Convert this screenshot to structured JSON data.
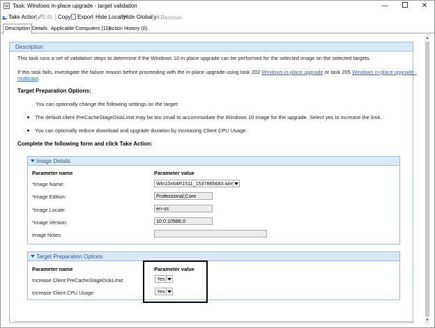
{
  "window": {
    "title": "Task: Windows in-place upgrade - target validation",
    "controls": {
      "minimize": "—",
      "close": "✕"
    }
  },
  "toolbar": {
    "take_action": "Take Action",
    "edit": "Edit",
    "copy": "Copy",
    "export": "Export",
    "hide_locally": "Hide Locally",
    "hide_globally": "Hide Globally",
    "remove": "Remove",
    "remove_icon": "✕"
  },
  "tabs": [
    {
      "label": "Description"
    },
    {
      "label": "Details"
    },
    {
      "label": "Applicable Computers (10)"
    },
    {
      "label": "Action History (0)"
    }
  ],
  "description": {
    "header": "Description",
    "intro": "This task runs a set of validation steps to determine if the Windows 10 in place upgrade can be performed for the selected image on the selected targets.",
    "fail_text_1": "If this task fails, investigate the failure reason before proceeding with the in-place upgrade using task 202 ",
    "fail_link_1": "Windows in-place upgrade",
    "fail_text_2": " or task 205 ",
    "fail_link_2a": "Windows in-place upgrade -",
    "fail_link_2b": "multicast",
    "fail_text_3": ".",
    "target_prep_title": "Target Preparation Options:",
    "optional_text": "You can optionally change the following settings on the target:",
    "bullet_1": "The default client PreCacheStageDiskLimit may be too small to accommodate the Windows 10 image for the upgrade. Select yes to increase the limit.",
    "bullet_2": "You can optionally reduce download and upgrade duration by increasing Client CPU Usage.",
    "complete_form": "Complete the following form and click Take Action:"
  },
  "image_details": {
    "header": "Image Details",
    "col_name": "Parameter name",
    "col_value": "Parameter value",
    "rows": [
      {
        "label": "*Image Name:",
        "value": "Win10x64R1511_1537885683.wim"
      },
      {
        "label": "*Image Edition:",
        "value": "Professional;Core"
      },
      {
        "label": "*Image Locale:",
        "value": "en-us"
      },
      {
        "label": "*Image Version:",
        "value": "10.0.10586.0"
      },
      {
        "label": "Image Notes:",
        "value": ""
      }
    ]
  },
  "target_options": {
    "header": "Target Preparation Options",
    "col_name": "Parameter name",
    "col_value": "Parameter value",
    "rows": [
      {
        "label": "Increase Client PreCacheStageDiskLimit:",
        "value": "Yes"
      },
      {
        "label": "Increase Client CPU Usage:",
        "value": "Yes"
      }
    ]
  },
  "colors": {
    "section_header_bg": "#dbe8f5",
    "section_header_text": "#2f5b90",
    "link": "#2e62b8",
    "highlight_border": "#000000"
  },
  "icons": {
    "app": "task-window-icon",
    "take_action": "take-action-icon",
    "edit": "pencil-icon",
    "copy": "copy-icon",
    "export": "export-icon",
    "remove": "remove-x-icon"
  }
}
